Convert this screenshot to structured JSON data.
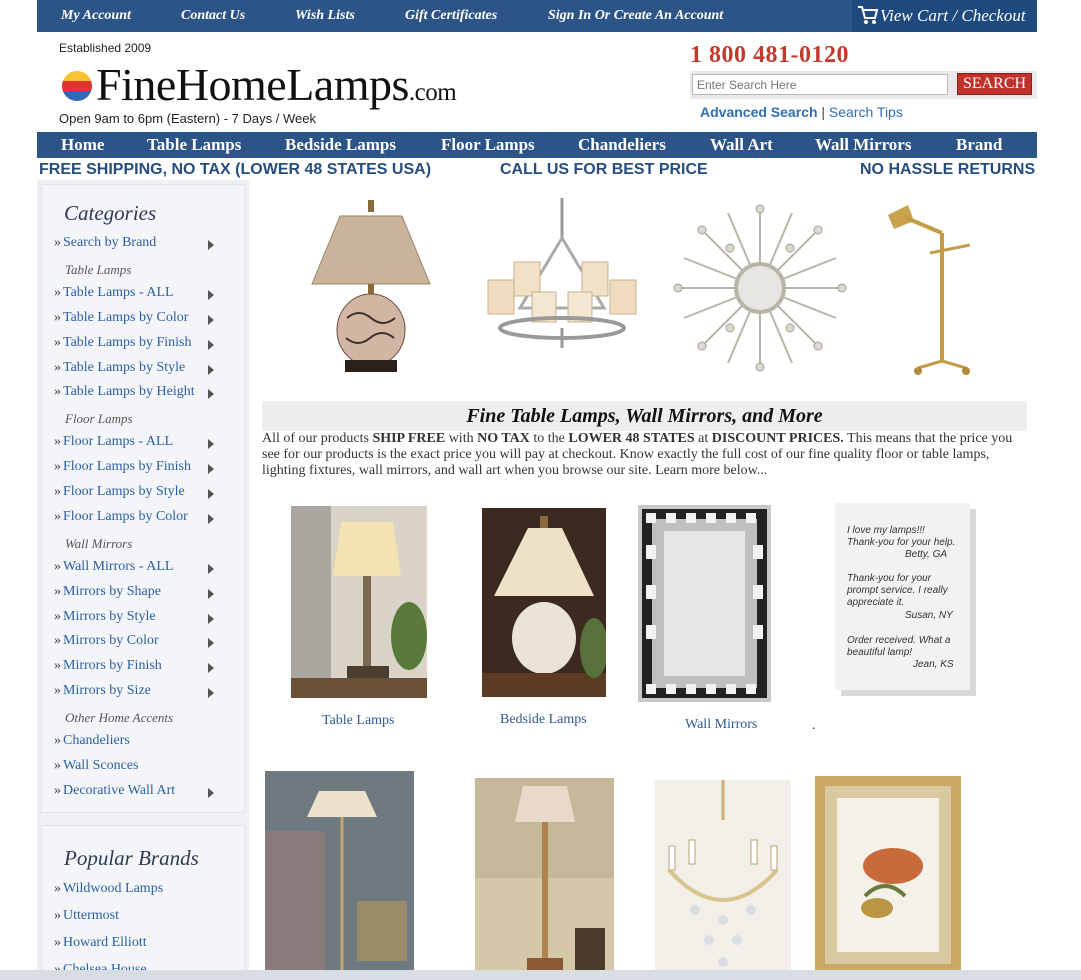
{
  "topnav": {
    "links": [
      "My Account",
      "Contact Us",
      "Wish Lists",
      "Gift Certificates",
      "Sign In Or Create An Account"
    ],
    "cart": "View Cart / Checkout"
  },
  "header": {
    "established": "Established 2009",
    "logo_main": "FineHomeLamps",
    "logo_suffix": ".com",
    "hours": "Open 9am to 6pm (Eastern) - 7 Days / Week",
    "phone": "1 800 481-0120",
    "search_placeholder": "Enter Search Here",
    "search_button": "SEARCH",
    "advanced_search": "Advanced Search",
    "separator": "|",
    "search_tips": "Search Tips"
  },
  "mainnav": [
    "Home",
    "Table Lamps",
    "Bedside Lamps",
    "Floor Lamps",
    "Chandeliers",
    "Wall Art",
    "Wall Mirrors",
    "Brand"
  ],
  "promo": {
    "left": "FREE SHIPPING, NO TAX (LOWER 48 STATES USA)",
    "center": "CALL US FOR BEST PRICE",
    "right": "NO HASSLE RETURNS"
  },
  "sidebar": {
    "categories_title": "Categories",
    "items": [
      {
        "label": "Search by Brand",
        "type": "link",
        "arrow": true
      },
      {
        "label": "Table Lamps",
        "type": "sub"
      },
      {
        "label": "Table Lamps - ALL",
        "type": "link",
        "arrow": true
      },
      {
        "label": "Table Lamps by Color",
        "type": "link",
        "arrow": true
      },
      {
        "label": "Table Lamps by Finish",
        "type": "link",
        "arrow": true
      },
      {
        "label": "Table Lamps by Style",
        "type": "link",
        "arrow": true
      },
      {
        "label": "Table Lamps by Height",
        "type": "link",
        "arrow": true
      },
      {
        "label": "Floor Lamps",
        "type": "sub"
      },
      {
        "label": "Floor Lamps - ALL",
        "type": "link",
        "arrow": true
      },
      {
        "label": "Floor Lamps by Finish",
        "type": "link",
        "arrow": true
      },
      {
        "label": "Floor Lamps by Style",
        "type": "link",
        "arrow": true
      },
      {
        "label": "Floor Lamps by Color",
        "type": "link",
        "arrow": true
      },
      {
        "label": "Wall Mirrors",
        "type": "sub"
      },
      {
        "label": "Wall Mirrors - ALL",
        "type": "link",
        "arrow": true
      },
      {
        "label": "Mirrors by Shape",
        "type": "link",
        "arrow": true
      },
      {
        "label": "Mirrors by Style",
        "type": "link",
        "arrow": true
      },
      {
        "label": "Mirrors by Color",
        "type": "link",
        "arrow": true
      },
      {
        "label": "Mirrors by Finish",
        "type": "link",
        "arrow": true
      },
      {
        "label": "Mirrors by Size",
        "type": "link",
        "arrow": true
      },
      {
        "label": "Other Home Accents",
        "type": "sub"
      },
      {
        "label": "Chandeliers",
        "type": "link",
        "arrow": false
      },
      {
        "label": "Wall Sconces",
        "type": "link",
        "arrow": false
      },
      {
        "label": "Decorative Wall Art",
        "type": "link",
        "arrow": true
      }
    ],
    "brands_title": "Popular Brands",
    "brands": [
      "Wildwood Lamps",
      "Uttermost",
      "Howard Elliott",
      "Chelsea House"
    ]
  },
  "content": {
    "welcome_title": "Fine Table Lamps, Wall Mirrors, and More",
    "intro_parts": [
      {
        "t": "All of our products ",
        "b": false
      },
      {
        "t": "SHIP FREE",
        "b": true
      },
      {
        "t": " with ",
        "b": false
      },
      {
        "t": "NO TAX",
        "b": true
      },
      {
        "t": " to the ",
        "b": false
      },
      {
        "t": "LOWER 48 STATES",
        "b": true
      },
      {
        "t": " at ",
        "b": false
      },
      {
        "t": "DISCOUNT PRICES.",
        "b": true
      },
      {
        "t": " This means that the price you see for our products is the exact price you will pay at checkout.  Know exactly the full cost of our fine quality floor or table lamps, lighting fixtures, wall mirrors, and wall art when you browse our site. Learn more below...",
        "b": false
      }
    ],
    "products": [
      "Table Lamps",
      "Bedside Lamps",
      "Wall Mirrors"
    ],
    "dot": ".",
    "testimonials": [
      "I love my lamps!!!",
      "Thank-you for your help.",
      "Betty, GA",
      "Thank-you for your",
      "prompt service. I really",
      "appreciate it.",
      "Susan, NY",
      "Order received. What a",
      "beautiful lamp!",
      "Jean, KS"
    ]
  },
  "colors": {
    "nav_blue": "#2d5486",
    "link_blue": "#2a5fa0",
    "phone_red": "#c23a2c",
    "search_red": "#c0322a"
  }
}
